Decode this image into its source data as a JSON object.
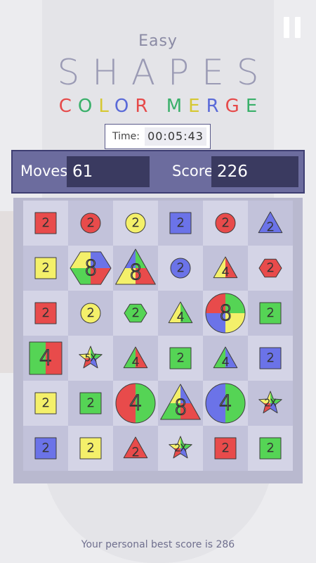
{
  "header": {
    "difficulty": "Easy",
    "title_word": "SHAPES",
    "subtitle_letters": [
      {
        "ch": "C",
        "color": "#e64a4a"
      },
      {
        "ch": "O",
        "color": "#3ab06a"
      },
      {
        "ch": "L",
        "color": "#d6c832"
      },
      {
        "ch": "O",
        "color": "#5a6ad8"
      },
      {
        "ch": "R",
        "color": "#e64a4a"
      },
      {
        "ch": " ",
        "color": "#ffffff"
      },
      {
        "ch": "M",
        "color": "#3ab06a"
      },
      {
        "ch": "E",
        "color": "#d6c832"
      },
      {
        "ch": "R",
        "color": "#5a6ad8"
      },
      {
        "ch": "G",
        "color": "#e64a4a"
      },
      {
        "ch": "E",
        "color": "#3ab06a"
      }
    ]
  },
  "timer": {
    "label": "Time:",
    "value": "00:05:43"
  },
  "stats": {
    "moves_label": "Moves:",
    "moves": "61",
    "score_label": "Score:",
    "score": "226"
  },
  "footer": {
    "text": "Your personal best score is 286"
  },
  "colors": {
    "red": "#e84b4b",
    "green": "#55d455",
    "yellow": "#f4f06a",
    "blue": "#6b73e8",
    "cell_light": "#d4d4e6",
    "cell_dark": "#c2c2da"
  },
  "board": [
    [
      {
        "shape": "square",
        "colors": [
          "red"
        ],
        "label": "2"
      },
      {
        "shape": "circle",
        "colors": [
          "red"
        ],
        "label": "2"
      },
      {
        "shape": "circle",
        "colors": [
          "yellow"
        ],
        "label": "2"
      },
      {
        "shape": "square",
        "colors": [
          "blue"
        ],
        "label": "2"
      },
      {
        "shape": "circle",
        "colors": [
          "red"
        ],
        "label": "2"
      },
      {
        "shape": "triangle",
        "colors": [
          "blue"
        ],
        "label": "2"
      }
    ],
    [
      {
        "shape": "square",
        "colors": [
          "yellow"
        ],
        "label": "2"
      },
      {
        "shape": "hexagon",
        "colors": [
          "yellow",
          "blue",
          "red",
          "green"
        ],
        "label": "8",
        "big": true
      },
      {
        "shape": "triangle",
        "colors": [
          "blue",
          "green",
          "red",
          "yellow"
        ],
        "label": "8",
        "big": true
      },
      {
        "shape": "circle",
        "colors": [
          "blue"
        ],
        "label": "2"
      },
      {
        "shape": "triangle",
        "colors": [
          "yellow",
          "red"
        ],
        "label": "4"
      },
      {
        "shape": "hexagon",
        "colors": [
          "red"
        ],
        "label": "2"
      }
    ],
    [
      {
        "shape": "square",
        "colors": [
          "red"
        ],
        "label": "2"
      },
      {
        "shape": "circle",
        "colors": [
          "yellow"
        ],
        "label": "2"
      },
      {
        "shape": "hexagon",
        "colors": [
          "green"
        ],
        "label": "2"
      },
      {
        "shape": "triangle",
        "colors": [
          "yellow",
          "green"
        ],
        "label": "4"
      },
      {
        "shape": "circle",
        "colors": [
          "red",
          "green",
          "yellow",
          "blue"
        ],
        "label": "8",
        "big": true
      },
      {
        "shape": "square",
        "colors": [
          "green"
        ],
        "label": "2"
      }
    ],
    [
      {
        "shape": "square",
        "colors": [
          "green",
          "red"
        ],
        "label": "4",
        "big": true
      },
      {
        "shape": "star",
        "colors": [
          "yellow",
          "green",
          "blue",
          "red"
        ],
        "label": "5X"
      },
      {
        "shape": "triangle",
        "colors": [
          "green",
          "red"
        ],
        "label": "4"
      },
      {
        "shape": "square",
        "colors": [
          "green"
        ],
        "label": "2"
      },
      {
        "shape": "triangle",
        "colors": [
          "green",
          "blue"
        ],
        "label": "4"
      },
      {
        "shape": "square",
        "colors": [
          "blue"
        ],
        "label": "2"
      }
    ],
    [
      {
        "shape": "square",
        "colors": [
          "yellow"
        ],
        "label": "2"
      },
      {
        "shape": "square",
        "colors": [
          "green"
        ],
        "label": "2"
      },
      {
        "shape": "circle",
        "colors": [
          "red",
          "green"
        ],
        "label": "4",
        "big": true
      },
      {
        "shape": "triangle",
        "colors": [
          "yellow",
          "blue",
          "red",
          "green"
        ],
        "label": "8",
        "big": true
      },
      {
        "shape": "circle",
        "colors": [
          "blue",
          "green"
        ],
        "label": "4",
        "big": true
      },
      {
        "shape": "star",
        "colors": [
          "yellow",
          "green",
          "blue",
          "red"
        ],
        "label": "2X"
      }
    ],
    [
      {
        "shape": "square",
        "colors": [
          "blue"
        ],
        "label": "2"
      },
      {
        "shape": "square",
        "colors": [
          "yellow"
        ],
        "label": "2"
      },
      {
        "shape": "triangle",
        "colors": [
          "red"
        ],
        "label": "2"
      },
      {
        "shape": "star",
        "colors": [
          "yellow",
          "green",
          "blue",
          "red"
        ],
        "label": "2X"
      },
      {
        "shape": "square",
        "colors": [
          "red"
        ],
        "label": "2"
      },
      {
        "shape": "square",
        "colors": [
          "green"
        ],
        "label": "2"
      }
    ]
  ]
}
